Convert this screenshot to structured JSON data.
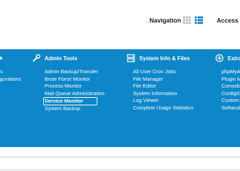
{
  "header": {
    "navigation_label": "Navigation",
    "access_label": "Access Le"
  },
  "columns": [
    {
      "title": "",
      "icon": "arrow-right-icon",
      "items": [
        "gs",
        "figurations"
      ]
    },
    {
      "title": "Admin Tools",
      "icon": "tools-icon",
      "items": [
        "Admin Backup/Transfer",
        "Brute Force Monitor",
        "Process Monitor",
        "Mail Queue Administration",
        "Service Monitor",
        "System Backup"
      ],
      "active": "Service Monitor"
    },
    {
      "title": "System Info & Files",
      "icon": "server-icon",
      "items": [
        "All User Cron Jobs",
        "File Manager",
        "File Editor",
        "System Information",
        "Log Viewer",
        "Complete Usage Statistics"
      ]
    },
    {
      "title": "Extra",
      "icon": "plus-icon",
      "items": [
        "phpMyA",
        "Plugin M",
        "Comodo",
        "ConfigSe",
        "Custom",
        "Softacul"
      ]
    }
  ],
  "colors": {
    "panel_bg": "#0d87c9",
    "text": "#ffffff",
    "icon_blue": "#1b8bd0"
  }
}
